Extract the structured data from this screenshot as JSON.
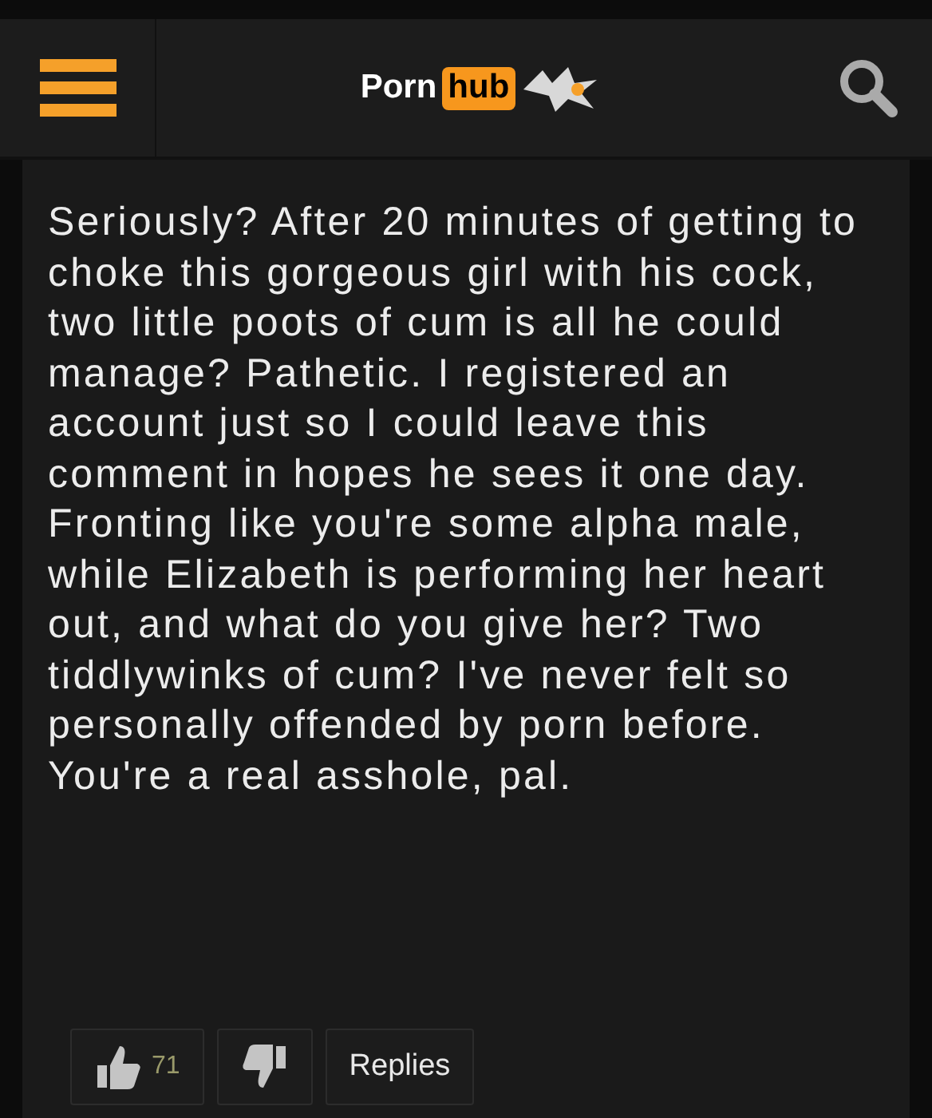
{
  "header": {
    "logo": {
      "word_1": "Porn",
      "word_2": "hub"
    }
  },
  "comment": {
    "lines": [
      "Seriously? After 20 minutes of getting to",
      "choke this gorgeous girl with his cock,",
      "two little poots of cum is all he could",
      "manage? Pathetic. I registered an",
      "account just so I could leave this",
      "comment in hopes he sees it one day.",
      "Fronting like you're some alpha male,",
      "while Elizabeth is performing her heart",
      "out, and what do you give her? Two",
      "tiddlywinks of cum? I've never felt so",
      "personally offended by porn before.",
      "You're a real asshole, pal."
    ]
  },
  "actions": {
    "likes": "71",
    "replies": "Replies"
  }
}
